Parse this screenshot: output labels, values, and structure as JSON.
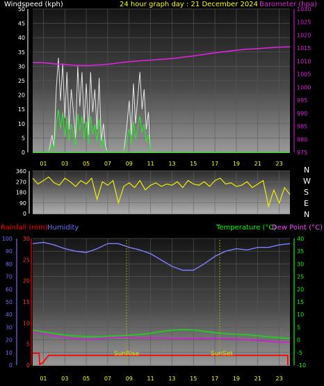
{
  "top": {
    "title": "24 hour graph day : 21 December 2024",
    "left_label": "Windspeed (kph)",
    "right_label": "Barometer (hpa)",
    "left_ticks": [
      50,
      45,
      40,
      35,
      30,
      25,
      20,
      15,
      10,
      5,
      0
    ],
    "right_ticks": [
      1030,
      1025,
      1020,
      1015,
      1010,
      1005,
      1000,
      995,
      990,
      985,
      980,
      975
    ],
    "x_ticks": [
      "01",
      "03",
      "05",
      "07",
      "09",
      "11",
      "13",
      "15",
      "17",
      "19",
      "21",
      "23"
    ]
  },
  "middle": {
    "left_ticks": [
      360,
      270,
      180,
      90,
      0
    ],
    "compass": [
      "N",
      "W",
      "S",
      "E",
      "N"
    ]
  },
  "bottom": {
    "rainfall_label": "Rainfall (mm)",
    "humidity_label": "Humidity",
    "temperature_label": "Temperature (°C)",
    "dewpoint_label": "Dew Point (°C)",
    "humidity_ticks": [
      100,
      90,
      80,
      70,
      60,
      50,
      40,
      30,
      20,
      10,
      0
    ],
    "rain_ticks": [
      30,
      25,
      20,
      15,
      10,
      5,
      0
    ],
    "temp_ticks": [
      40,
      35,
      30,
      25,
      20,
      15,
      10,
      5,
      0,
      -5,
      -10
    ],
    "x_ticks": [
      "01",
      "03",
      "05",
      "07",
      "09",
      "11",
      "13",
      "15",
      "17",
      "19",
      "21",
      "23"
    ],
    "sunrise_label": "SunRise",
    "sunset_label": "SunSet"
  },
  "colors": {
    "wind": "#e8e8e8",
    "gust": "#dddddd",
    "avgwind": "#33dd33",
    "baro": "#dd22dd",
    "direction": "#eeee00",
    "humidity": "#7f7fff",
    "temperature": "#22cc22",
    "dewpoint": "#cc22cc",
    "rain": "#ff0000",
    "title": "#ffff00",
    "left_axis_top": "#ffffff",
    "temp_axis": "#00ff00",
    "humid_axis": "#6f6fff"
  },
  "chart_data": [
    {
      "type": "line",
      "title": "24 hour graph day : 21 December 2024",
      "xlabel": "",
      "ylabel": "Windspeed (kph)",
      "y2label": "Barometer (hpa)",
      "ylim": [
        0,
        50
      ],
      "y2lim": [
        975,
        1030
      ],
      "series": [
        {
          "name": "Windspeed (kph)",
          "axis": "left",
          "x": [
            0,
            1,
            1.5,
            1.8,
            2.0,
            2.2,
            2.4,
            2.6,
            2.8,
            3.0,
            3.2,
            3.4,
            3.6,
            3.8,
            4.0,
            4.2,
            4.4,
            4.6,
            4.8,
            5.0,
            5.2,
            5.4,
            5.6,
            5.8,
            6.0,
            6.2,
            6.4,
            6.6,
            6.8,
            7,
            8,
            8.5,
            8.8,
            9.0,
            9.2,
            9.4,
            9.6,
            9.8,
            10.0,
            10.2,
            10.4,
            10.6,
            10.8,
            11,
            12,
            24
          ],
          "y": [
            0,
            0,
            0,
            6,
            2,
            22,
            33,
            18,
            31,
            12,
            28,
            8,
            22,
            14,
            5,
            30,
            16,
            28,
            10,
            24,
            6,
            28,
            14,
            22,
            8,
            26,
            4,
            10,
            2,
            0,
            0,
            0,
            10,
            18,
            6,
            24,
            10,
            19,
            28,
            15,
            22,
            8,
            14,
            0,
            0,
            0
          ]
        },
        {
          "name": "Barometer (hpa)",
          "axis": "right",
          "x": [
            0,
            1,
            2,
            3,
            4,
            5,
            6,
            7,
            8,
            9,
            10,
            11,
            12,
            13,
            14,
            15,
            16,
            17,
            18,
            19,
            20,
            21,
            22,
            23,
            24
          ],
          "y": [
            1009.5,
            1009.4,
            1009,
            1008.7,
            1008.4,
            1008.3,
            1008.5,
            1008.8,
            1009.3,
            1009.8,
            1010.1,
            1010.4,
            1010.7,
            1011,
            1011.5,
            1012,
            1012.6,
            1013.2,
            1013.7,
            1014.2,
            1014.6,
            1014.8,
            1015.1,
            1015.4,
            1015.5
          ]
        }
      ]
    },
    {
      "type": "line",
      "title": "",
      "xlabel": "",
      "ylabel": "",
      "ylim": [
        0,
        360
      ],
      "series": [
        {
          "name": "",
          "x": [
            0,
            0.5,
            1,
            1.5,
            2,
            2.5,
            3,
            3.5,
            4,
            4.5,
            5,
            5.5,
            6,
            6.5,
            7,
            7.5,
            8,
            8.5,
            9,
            9.5,
            10,
            10.5,
            11,
            11.5,
            12,
            12.5,
            13,
            13.5,
            14,
            14.5,
            15,
            15.5,
            16,
            16.5,
            17,
            17.5,
            18,
            18.5,
            19,
            19.5,
            20,
            20.5,
            21,
            21.5,
            22,
            22.5,
            23,
            23.5,
            24
          ],
          "y": [
            300,
            250,
            280,
            310,
            260,
            240,
            300,
            270,
            230,
            280,
            250,
            300,
            120,
            270,
            240,
            280,
            90,
            230,
            260,
            220,
            280,
            200,
            240,
            260,
            230,
            250,
            240,
            270,
            220,
            280,
            250,
            240,
            270,
            230,
            280,
            300,
            250,
            260,
            230,
            240,
            270,
            220,
            250,
            280,
            60,
            200,
            90,
            220,
            160
          ]
        }
      ]
    },
    {
      "type": "line",
      "title": "",
      "xlabel": "",
      "ylabel": "Humidity",
      "y2label": "Temperature (°C)",
      "ylim": [
        0,
        100
      ],
      "y2lim": [
        -10,
        40
      ],
      "series": [
        {
          "name": "Humidity",
          "axis": "left",
          "x": [
            0,
            1,
            2,
            3,
            4,
            5,
            6,
            7,
            8,
            9,
            10,
            11,
            12,
            13,
            14,
            15,
            16,
            17,
            18,
            19,
            20,
            21,
            22,
            23,
            24
          ],
          "y": [
            96,
            97,
            95,
            92,
            90,
            89,
            92,
            96,
            96,
            93,
            91,
            88,
            83,
            78,
            75,
            75,
            80,
            86,
            90,
            92,
            91,
            93,
            93,
            95,
            96
          ]
        },
        {
          "name": "Temperature (°C)",
          "axis": "right",
          "x": [
            0,
            1,
            2,
            3,
            4,
            5,
            6,
            7,
            8,
            9,
            10,
            11,
            12,
            13,
            14,
            15,
            16,
            17,
            18,
            19,
            20,
            21,
            22,
            23,
            24
          ],
          "y": [
            3.8,
            3.2,
            2.5,
            1.9,
            1.5,
            1.3,
            1.3,
            1.4,
            1.6,
            1.8,
            2.1,
            2.6,
            3.3,
            3.8,
            4.0,
            3.9,
            3.4,
            2.8,
            2.4,
            2.2,
            2.0,
            1.6,
            1.2,
            0.8,
            0.5
          ]
        },
        {
          "name": "Dew Point (°C)",
          "axis": "right",
          "x": [
            0,
            1,
            2,
            3,
            4,
            5,
            6,
            7,
            8,
            9,
            10,
            11,
            12,
            13,
            14,
            15,
            16,
            17,
            18,
            19,
            20,
            21,
            22,
            23,
            24
          ],
          "y": [
            3.2,
            2.5,
            1.6,
            0.9,
            0.4,
            0.1,
            0.3,
            0.8,
            1.1,
            1.0,
            0.7,
            0.8,
            0.7,
            0.6,
            0.5,
            0.5,
            0.5,
            0.6,
            0.4,
            0.2,
            0.0,
            -0.3,
            -0.6,
            -0.9,
            -1.0
          ]
        },
        {
          "name": "Rainfall (mm)",
          "axis": "left-rain",
          "x": [
            0,
            0.6,
            0.65,
            0.9,
            1.5,
            2.5,
            24
          ],
          "y": [
            2.8,
            2.8,
            0.2,
            0.5,
            2.3,
            2.3,
            2.3
          ]
        }
      ]
    }
  ]
}
